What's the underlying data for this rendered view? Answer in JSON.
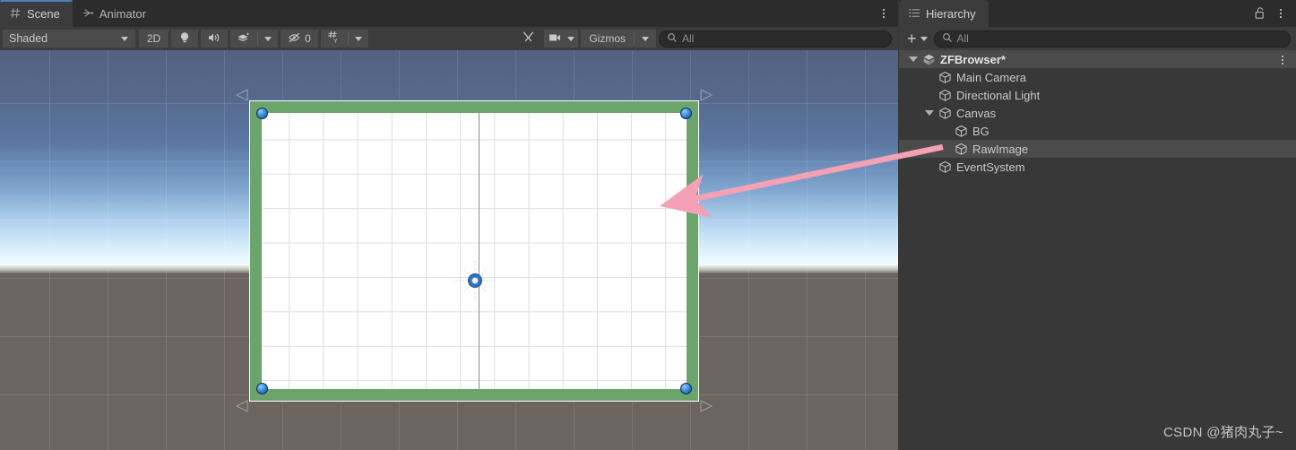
{
  "window": {
    "watermark": "CSDN @猪肉丸子~"
  },
  "scene_panel": {
    "tabs": [
      {
        "label": "Scene",
        "icon": "grid-hash-icon",
        "active": true
      },
      {
        "label": "Animator",
        "icon": "animator-icon",
        "active": false
      }
    ],
    "options_menu": "kebab-menu",
    "toolbar": {
      "draw_mode": "Shaded",
      "two_d_button": "2D",
      "lighting_icon": "lightbulb-icon",
      "audio_icon": "speaker-icon",
      "fx_icon": "effects-icon",
      "hidden_count": "0",
      "hidden_icon": "eye-slash-icon",
      "grid_icon": "grid-axis-icon",
      "grid_axis": "Y",
      "tools_icon": "wrench-screwdriver-icon",
      "camera_icon": "camera-icon",
      "gizmos_label": "Gizmos",
      "search_placeholder": "All",
      "search_value": ""
    }
  },
  "hierarchy_panel": {
    "tab": {
      "label": "Hierarchy",
      "icon": "hierarchy-list-icon"
    },
    "lock_icon": "lock-open-icon",
    "options_menu": "kebab-menu",
    "toolbar": {
      "add_label": "+",
      "search_placeholder": "All",
      "search_value": ""
    },
    "tree": [
      {
        "label": "ZFBrowser*",
        "depth": 0,
        "type": "scene",
        "expanded": true,
        "selected": false,
        "has_menu": true
      },
      {
        "label": "Main Camera",
        "depth": 1,
        "type": "gameobject",
        "expanded": null,
        "selected": false,
        "has_menu": false
      },
      {
        "label": "Directional Light",
        "depth": 1,
        "type": "gameobject",
        "expanded": null,
        "selected": false,
        "has_menu": false
      },
      {
        "label": "Canvas",
        "depth": 1,
        "type": "gameobject",
        "expanded": true,
        "selected": false,
        "has_menu": false
      },
      {
        "label": "BG",
        "depth": 2,
        "type": "gameobject",
        "expanded": null,
        "selected": false,
        "has_menu": false
      },
      {
        "label": "RawImage",
        "depth": 2,
        "type": "gameobject",
        "expanded": null,
        "selected": true,
        "has_menu": false
      },
      {
        "label": "EventSystem",
        "depth": 1,
        "type": "gameobject",
        "expanded": null,
        "selected": false,
        "has_menu": false
      }
    ]
  },
  "annotation": {
    "arrow_color": "#f4a0b5",
    "arrow_name": "pink-pointer-arrow",
    "points_from": "RawImage",
    "points_to": "selected-canvas-rect"
  },
  "colors": {
    "panel_bg": "#383838",
    "toolbar_bg": "#3c3c3c",
    "tab_bg": "#2c2c2c",
    "accent_blue": "#4a7ebb",
    "selection_green": "#6ba46d",
    "handle_blue": "#3d8fdd",
    "ground": "#6c645f"
  }
}
